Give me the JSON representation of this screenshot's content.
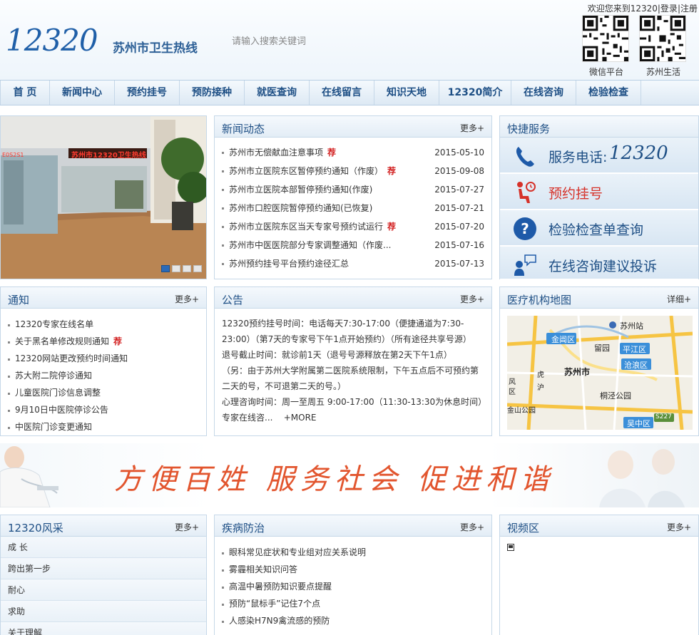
{
  "header": {
    "logo_number": "12320",
    "logo_text": "苏州市卫生热线",
    "search_placeholder": "请输入搜索关键词",
    "welcome": "欢迎您来到12320",
    "login": "登录",
    "register": "注册",
    "qr_codes": [
      {
        "label": "微信平台"
      },
      {
        "label": "苏州生活"
      }
    ]
  },
  "nav": {
    "items": [
      "首 页",
      "新闻中心",
      "预约挂号",
      "预防接种",
      "就医查询",
      "在线留言",
      "知识天地",
      "12320简介",
      "在线咨询",
      "检验检查"
    ]
  },
  "slideshow": {
    "sign_text": "苏州市12320卫生热线",
    "side_text": "E0S2S1",
    "dots": [
      1,
      2,
      3,
      4
    ],
    "active_dot": 1
  },
  "news": {
    "title": "新闻动态",
    "more": "更多+",
    "items": [
      {
        "text": "苏州市无偿献血注意事项",
        "hot": "荐",
        "date": "2015-05-10"
      },
      {
        "text": "苏州市立医院东区暂停预约通知（作废）",
        "hot": "荐",
        "date": "2015-09-08"
      },
      {
        "text": "苏州市立医院本部暂停预约通知(作废)",
        "hot": "",
        "date": "2015-07-27"
      },
      {
        "text": "苏州市口腔医院暂停预约通知(已恢复)",
        "hot": "",
        "date": "2015-07-21"
      },
      {
        "text": "苏州市立医院东区当天专家号预约试运行",
        "hot": "荐",
        "date": "2015-07-20"
      },
      {
        "text": "苏州市中医医院部分专家调整通知（作废...",
        "hot": "",
        "date": "2015-07-16"
      },
      {
        "text": "苏州预约挂号平台预约途径汇总",
        "hot": "",
        "date": "2015-07-13"
      }
    ]
  },
  "quick": {
    "title": "快捷服务",
    "items": [
      {
        "label": "服务电话:",
        "number": "12320"
      },
      {
        "label": "预约挂号"
      },
      {
        "label": "检验检查单查询"
      },
      {
        "label": "在线咨询建议投诉"
      }
    ]
  },
  "notify": {
    "title": "通知",
    "more": "更多+",
    "items": [
      {
        "text": "12320专家在线名单",
        "hot": ""
      },
      {
        "text": "关于黑名单修改规则通知",
        "hot": "荐"
      },
      {
        "text": "12320网站更改预约时间通知",
        "hot": ""
      },
      {
        "text": "苏大附二院停诊通知",
        "hot": ""
      },
      {
        "text": "儿童医院门诊信息调整",
        "hot": ""
      },
      {
        "text": "9月10日中医院停诊公告",
        "hot": ""
      },
      {
        "text": "中医院门诊变更通知",
        "hot": ""
      }
    ]
  },
  "announce": {
    "title": "公告",
    "more": "更多+",
    "lines": [
      "12320预约挂号时间：电话每天7:30-17:00（便捷通道为7:30-",
      "23:00）（第7天的专家号下午1点开始预约）（所有途径共享号源）",
      "退号截止时间：就诊前1天（退号号源释放在第2天下午1点）",
      "（另：由于苏州大学附属第二医院系统限制，下午五点后不可预约第",
      "二天的号，不可退第二天的号。）",
      "心理咨询时间：周一至周五  9:00-17:00（11:30-13:30为休息时间）"
    ],
    "last_line": "专家在线咨...",
    "more_link": "+MORE"
  },
  "map": {
    "title": "医疗机构地图",
    "more": "详细+",
    "labels": [
      "苏州站",
      "金阊区",
      "留园",
      "平江区",
      "沧浪区",
      "苏州市",
      "桐泾公园",
      "吴中区",
      "S227",
      "风",
      "区",
      "虎",
      "沪",
      "金山公园"
    ]
  },
  "banner": {
    "text": "方便百姓 服务社会 促进和谐"
  },
  "fengcai": {
    "title": "12320风采",
    "more": "更多+",
    "items": [
      "成 长",
      "跨出第一步",
      "耐心",
      "求助",
      "关于理解"
    ]
  },
  "disease": {
    "title": "疾病防治",
    "more": "更多+",
    "items": [
      "眼科常见症状和专业组对应关系说明",
      "雾霾相关知识问答",
      "高温中暑预防知识要点提醒",
      "预防“鼠标手”记住7个点",
      "人感染H7N9禽流感的预防"
    ]
  },
  "video": {
    "title": "视频区",
    "more": "更多+"
  },
  "colors": {
    "brand": "#1e4f85",
    "hot": "#d21e1e",
    "banner": "#e2552e"
  }
}
